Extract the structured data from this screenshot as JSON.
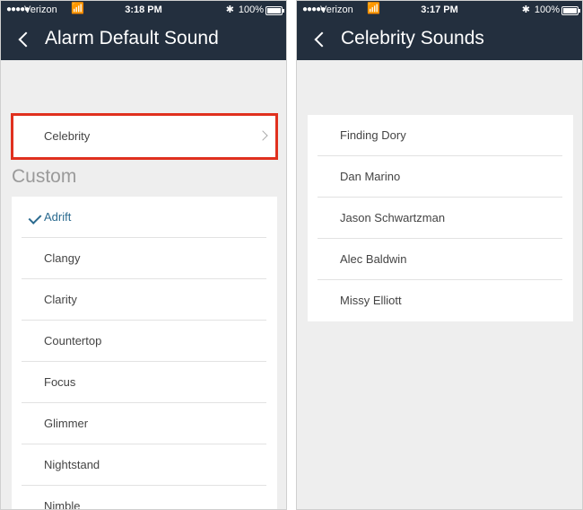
{
  "left": {
    "status": {
      "carrier": "Verizon",
      "time": "3:18 PM",
      "battery": "100%"
    },
    "title": "Alarm Default Sound",
    "celebrity_row": "Celebrity",
    "section_header": "Custom",
    "selected": "Adrift",
    "items": [
      "Adrift",
      "Clangy",
      "Clarity",
      "Countertop",
      "Focus",
      "Glimmer",
      "Nightstand",
      "Nimble"
    ]
  },
  "right": {
    "status": {
      "carrier": "Verizon",
      "time": "3:17 PM",
      "battery": "100%"
    },
    "title": "Celebrity Sounds",
    "items": [
      "Finding Dory",
      "Dan Marino",
      "Jason Schwartzman",
      "Alec Baldwin",
      "Missy Elliott"
    ]
  },
  "colors": {
    "navbar": "#232f3e",
    "highlight": "#e0301e",
    "selected": "#2a6a8f",
    "background": "#eeeeee"
  },
  "icons": [
    "signal-icon",
    "wifi-icon",
    "bluetooth-icon",
    "battery-icon",
    "back-chevron-icon",
    "chevron-right-icon",
    "checkmark-icon"
  ]
}
